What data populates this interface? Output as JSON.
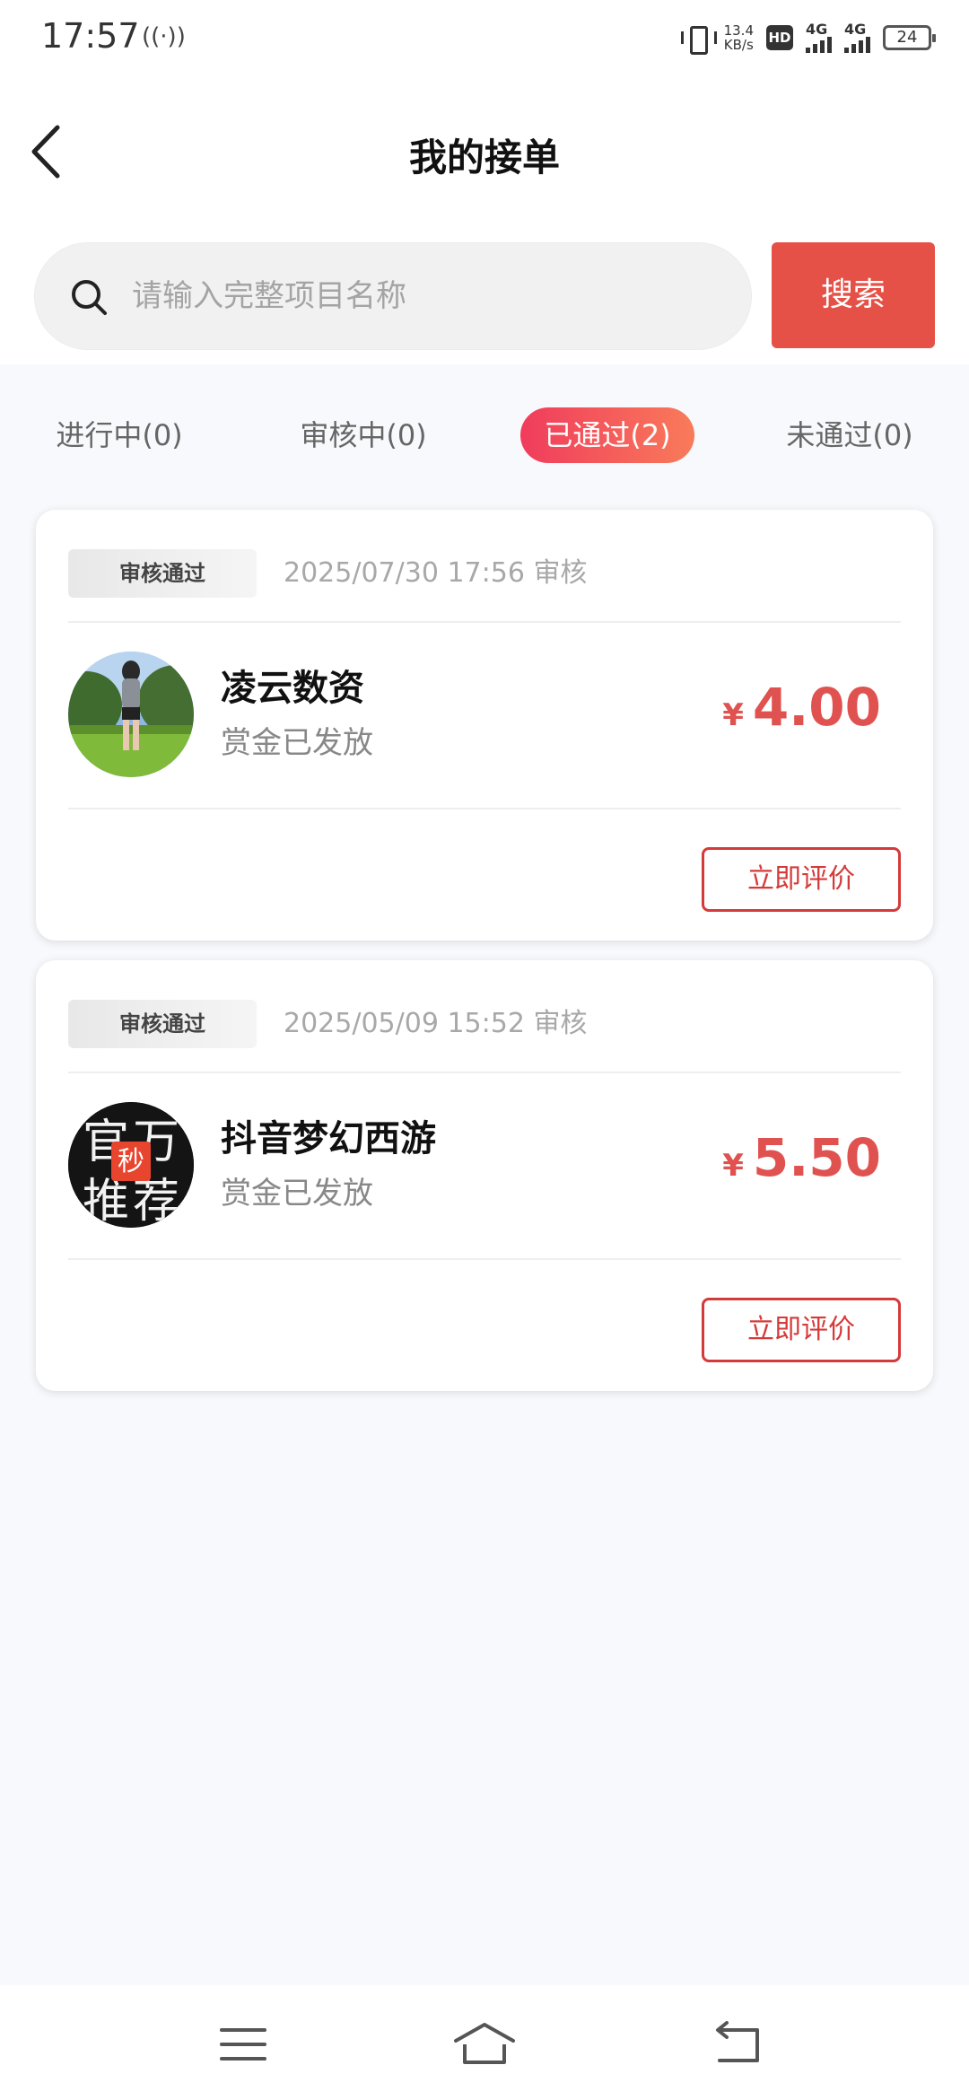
{
  "status_bar": {
    "time": "17:57",
    "nfc_icon": "((·))",
    "net_speed_value": "13.4",
    "net_speed_unit": "KB/s",
    "hd_label": "HD",
    "sim1_label": "4G",
    "sim2_label": "4G",
    "battery": "24"
  },
  "header": {
    "title": "我的接单",
    "back_icon": "chevron-left"
  },
  "search": {
    "placeholder": "请输入完整项目名称",
    "value": "",
    "button_label": "搜索"
  },
  "tabs": [
    {
      "label": "进行中(0)",
      "active": false
    },
    {
      "label": "审核中(0)",
      "active": false
    },
    {
      "label": "已通过(2)",
      "active": true
    },
    {
      "label": "未通过(0)",
      "active": false
    }
  ],
  "orders": [
    {
      "status": "审核通过",
      "time": "2025/07/30 17:56 审核",
      "name": "凌云数资",
      "subtitle": "赏金已发放",
      "currency": "¥",
      "amount": "4.00",
      "action_label": "立即评价"
    },
    {
      "status": "审核通过",
      "time": "2025/05/09 15:52 审核",
      "name": "抖音梦幻西游",
      "subtitle": "赏金已发放",
      "currency": "¥",
      "amount": "5.50",
      "action_label": "立即评价",
      "avatar_text": {
        "top_left": "官",
        "top_right": "万",
        "badge": "秒",
        "bottom_left": "推",
        "bottom_right": "荐"
      }
    }
  ],
  "colors": {
    "accent": "#e55147",
    "price": "#e05250",
    "tab_active_start": "#f03c5c",
    "tab_active_end": "#f97b5a"
  }
}
